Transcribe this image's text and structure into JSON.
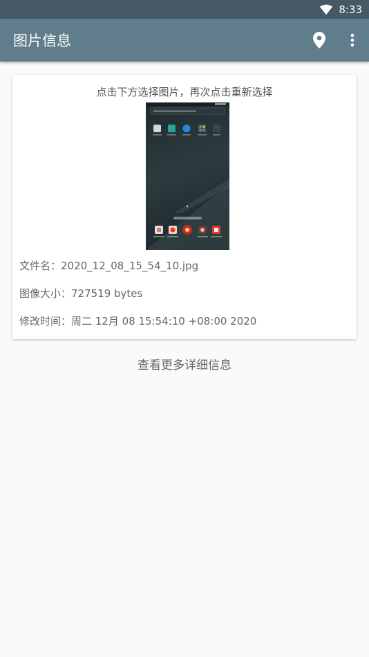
{
  "status_bar": {
    "time": "8:33"
  },
  "app_bar": {
    "title": "图片信息"
  },
  "card": {
    "hint": "点击下方选择图片，再次点击重新选择",
    "file_name": "文件名：2020_12_08_15_54_10.jpg",
    "image_size": "图像大小：727519 bytes",
    "modified_time": "修改时间：周二 12月 08 15:54:10 +08:00 2020"
  },
  "more_details": "查看更多详细信息",
  "colors": {
    "status_bar": "#455a64",
    "app_bar": "#607d8b",
    "background": "#fafafa"
  }
}
